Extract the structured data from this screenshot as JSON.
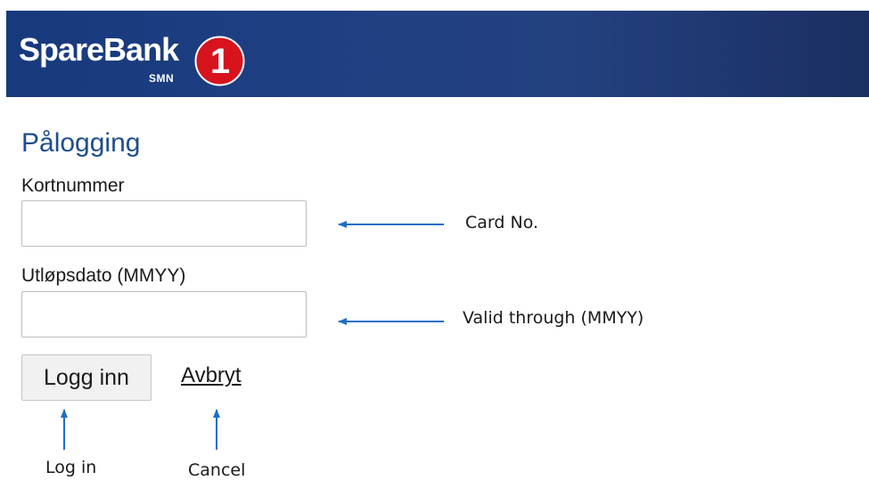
{
  "header": {
    "brand_name": "SpareBank",
    "brand_sub": "SMN",
    "logo_digit": "1",
    "colors": {
      "header_bg": "#1f3f83",
      "logo_red": "#d7141e"
    }
  },
  "form": {
    "title": "Pålogging",
    "card_label": "Kortnummer",
    "card_value": "",
    "expiry_label": "Utløpsdato (MMYY)",
    "expiry_value": "",
    "login_label": "Logg inn",
    "cancel_label": "Avbryt"
  },
  "annotations": {
    "card": "Card No.",
    "expiry": "Valid through (MMYY)",
    "login": "Log in",
    "cancel": "Cancel",
    "arrow_color": "#1f6fc5"
  }
}
